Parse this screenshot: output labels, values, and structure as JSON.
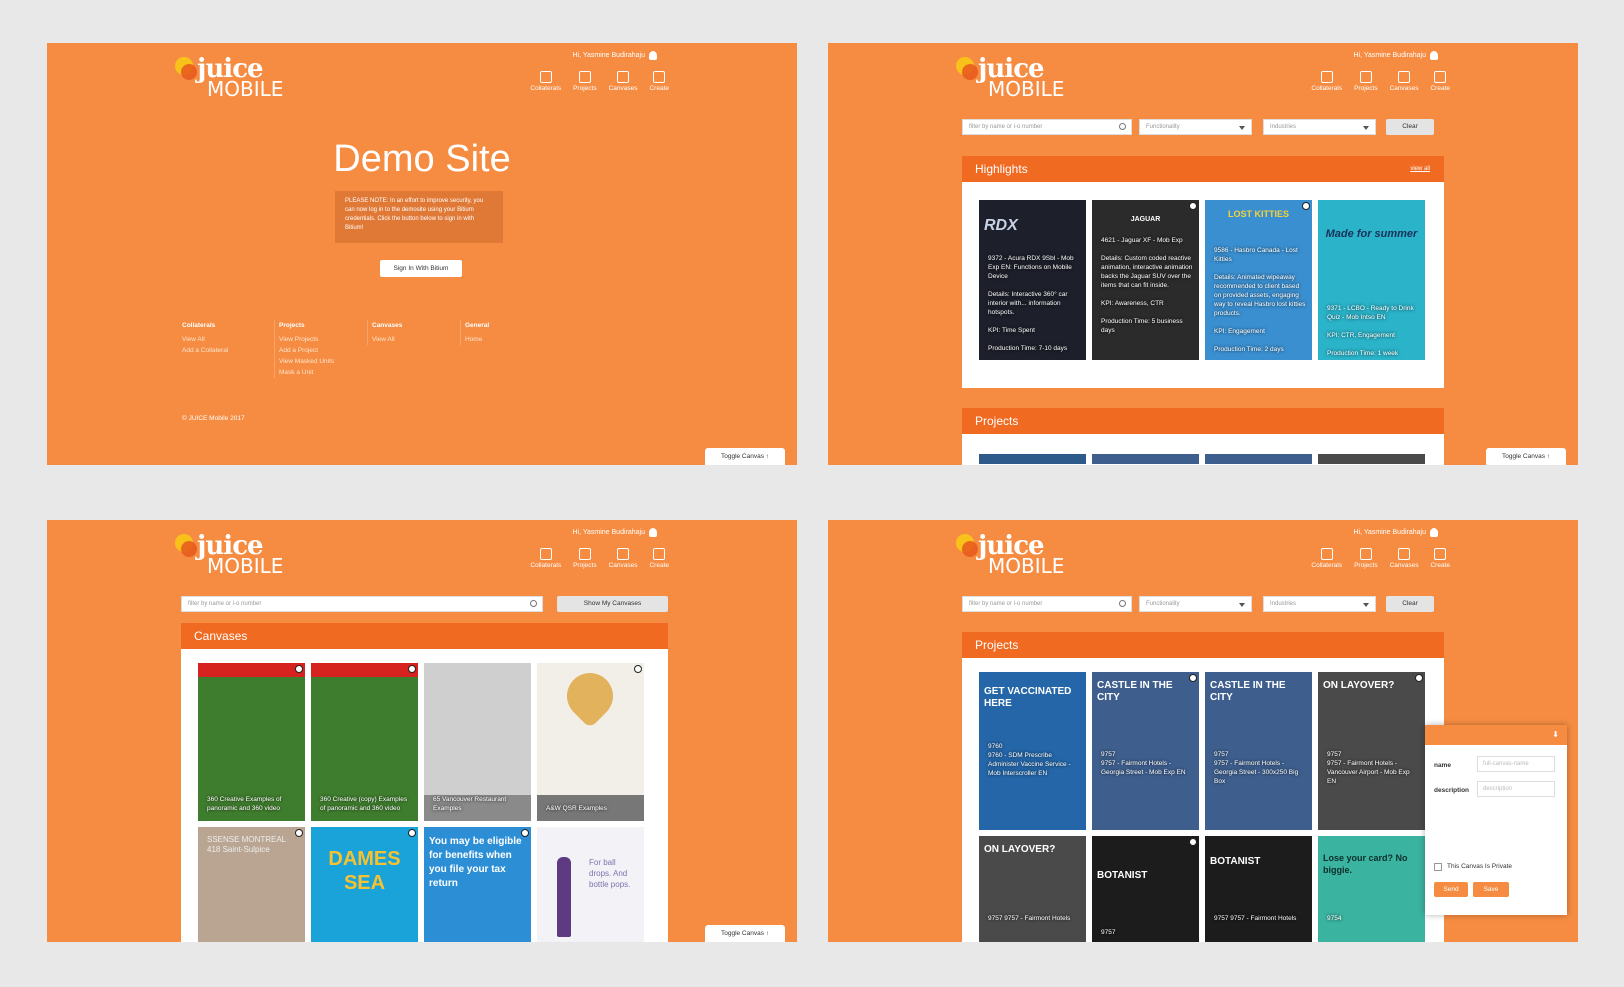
{
  "app": {
    "logo_line1": "juice",
    "logo_line2": "MOBILE",
    "user_greeting": "Hi, Yasmine Budirahaju"
  },
  "nav": [
    "Collaterals",
    "Projects",
    "Canvases",
    "Create"
  ],
  "toggle_label": "Toggle Canvas ↑",
  "home": {
    "title": "Demo Site",
    "note": "PLEASE NOTE: In an effort to improve security, you can now log in to the demosite using your Bitium credentials. Click the button below to sign in with Bitium!",
    "signin": "Sign In With Bitium",
    "footer": [
      {
        "head": "Collaterals",
        "links": [
          "View All",
          "Add a Collateral"
        ]
      },
      {
        "head": "Projects",
        "links": [
          "View Projects",
          "Add a Project",
          "View Masked Units",
          "Mask a Unit"
        ]
      },
      {
        "head": "Canvases",
        "links": [
          "View All"
        ]
      },
      {
        "head": "General",
        "links": [
          "Home"
        ]
      }
    ],
    "copyright": "© JUICE Mobile 2017"
  },
  "filters": {
    "search_placeholder": "filter by name or i-o number",
    "functionality": "Functionality",
    "industries": "Industries",
    "clear": "Clear",
    "show_my": "Show My Canvases"
  },
  "highlights": {
    "title": "Highlights",
    "view_all": "view all",
    "cards": [
      {
        "text": "9372 - Acura RDX 9Sbl - Mob Exp EN: Functions on Mobile Device\n\nDetails: Interactive 360° car interior with... information hotspots.\n\nKPI: Time Spent\n\nProduction Time: 7-10 days",
        "bg": "#1d1f2a",
        "brand": "RDX"
      },
      {
        "text": "4621 - Jaguar XF - Mob Exp\n\nDetails: Custom coded reactive animation, interactive animation backs the Jaguar SUV over the items that can fit inside.\n\nKPI: Awareness, CTR\n\nProduction Time: 5 business days",
        "bg": "#2b2b2b",
        "brand": "JAGUAR"
      },
      {
        "text": "9586 - Hasbro Canada - Lost Kitties\n\nDetails: Animated wipeaway recommended to client based on provided assets, engaging way to reveal Hasbro lost kitties products.\n\nKPI: Engagement\n\nProduction Time: 2 days",
        "bg": "#3a8fd0",
        "brand": "LOST KITTIES"
      },
      {
        "text": "9371 - LCBO - Ready to Drink Quiz - Mob Intso EN\n\nKPI: CTR, Engagement\n\nProduction Time: 1 week",
        "bg": "#2ab3c9",
        "brand": "Made for summer"
      }
    ]
  },
  "projects_title": "Projects",
  "canvases": {
    "title": "Canvases",
    "cards": [
      {
        "label": "360 Creative Examples of panoramic and 360 video",
        "bg": "#3f7d2e"
      },
      {
        "label": "360 Creative (copy) Examples of panoramic and 360 video",
        "bg": "#3f7d2e"
      },
      {
        "label": "65 Vancouver Restaurant Examples",
        "bg": "#cfcfcf"
      },
      {
        "label": "A&W QSR Examples",
        "bg": "#f2efe8"
      },
      {
        "label": "SSENSE MONTREAL 418 Saint-Sulpice",
        "bg": "#b9a591"
      },
      {
        "label": "DAMES SEA",
        "bg": "#1aa3d8"
      },
      {
        "label": "You may be eligible for benefits when you file your tax return",
        "bg": "#2c8fd6"
      },
      {
        "label": "For ball drops. And bottle pops.",
        "bg": "#f2f2f7"
      }
    ]
  },
  "project_cards": [
    {
      "head": "GET VACCINATED HERE",
      "text": "9760\n9760 - SDM Prescribe Administer Vaccine Service - Mob Interscroller EN",
      "bg": "#2466a8"
    },
    {
      "head": "CASTLE IN THE CITY",
      "text": "9757\n9757 - Fairmont Hotels - Georgia Street - Mob Exp EN",
      "bg": "#3e5f8e"
    },
    {
      "head": "CASTLE IN THE CITY",
      "text": "9757\n9757 - Fairmont Hotels - Georgia Street - 300x250 Big Box",
      "bg": "#3e5f8e"
    },
    {
      "head": "ON LAYOVER?",
      "text": "9757\n9757 - Fairmont Hotels - Vancouver Airport - Mob Exp EN",
      "bg": "#4a4a4a"
    },
    {
      "head": "ON LAYOVER?",
      "text": "9757  9757 - Fairmont Hotels",
      "bg": "#4a4a4a"
    },
    {
      "head": "BOTANIST",
      "text": "9757",
      "bg": "#1c1c1c"
    },
    {
      "head": "BOTANIST",
      "text": "9757  9757 - Fairmont Hotels",
      "bg": "#1c1c1c"
    },
    {
      "head": "Lose your card? No biggie.",
      "text": "9754",
      "bg": "#3ab3a0"
    }
  ],
  "canvas_popup": {
    "name_label": "name",
    "name_placeholder": "full-canvas-name",
    "desc_label": "description",
    "desc_placeholder": "description",
    "private_label": "This Canvas Is Private",
    "send": "Send",
    "save": "Save"
  }
}
